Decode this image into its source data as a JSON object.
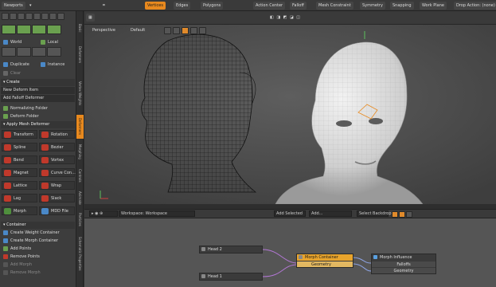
{
  "top_toolbar": {
    "layout_tab": "Newports",
    "vertices": "Vertices",
    "edges": "Edges",
    "polygons": "Polygons",
    "action_center": "Action Center",
    "falloff": "Falloff",
    "mesh_constraint": "Mesh Constraint",
    "symmetry": "Symmetry",
    "snapping": "Snapping",
    "work_plane": "Work Plane",
    "drop_action": "Drop Action: (none)"
  },
  "left_panel": {
    "world": "World",
    "local": "Local",
    "duplicate": "Duplicate",
    "instance": "Instance",
    "clear": "Clear",
    "create_header": "Create",
    "new_deform_item": "New Deform Item",
    "add_falloff_deformer": "Add Falloff Deformer",
    "normalizing_folder": "Normalizing Folder",
    "deform_folder": "Deform Folder",
    "apply_mesh_deformer": "Apply Mesh Deformer",
    "tools": [
      {
        "label": "Transform",
        "color": "#c0392b"
      },
      {
        "label": "Rotation",
        "color": "#c0392b"
      },
      {
        "label": "Spline",
        "color": "#c0392b"
      },
      {
        "label": "Bezier",
        "color": "#c0392b"
      },
      {
        "label": "Bend",
        "color": "#c0392b"
      },
      {
        "label": "Vortex",
        "color": "#c0392b"
      },
      {
        "label": "Magnet",
        "color": "#c0392b"
      },
      {
        "label": "Curve Con...",
        "color": "#c0392b"
      },
      {
        "label": "Lattice",
        "color": "#c0392b"
      },
      {
        "label": "Wrap",
        "color": "#c0392b"
      },
      {
        "label": "Lag",
        "color": "#c0392b"
      },
      {
        "label": "Slack",
        "color": "#c0392b"
      },
      {
        "label": "Morph",
        "color": "#4f8f3d"
      },
      {
        "label": "MDD File",
        "color": "#4a88c7"
      }
    ],
    "container_header": "Container",
    "create_weight_container": "Create Weight Container",
    "create_morph_container": "Create Morph Container",
    "add_points": "Add Points",
    "remove_points": "Remove Points",
    "add_morph": "Add Morph",
    "remove_morph": "Remove Morph"
  },
  "vertical_tabs": [
    "Basic",
    "Deformers",
    "Vertex Weights",
    "Deformers",
    "Morphing",
    "Controls",
    "Animate",
    "Particles",
    "Schematic Properties"
  ],
  "viewport": {
    "view_mode": "Perspective",
    "shading": "Default"
  },
  "schematic": {
    "workspace_label": "Workspace: Workspace",
    "add_selected": "Add Selected",
    "add_menu": "Add...",
    "select_backdrop": "Select Backdrop",
    "nodes": {
      "head2": "Head 2",
      "head1": "Head 1",
      "morph_container": "Morph Container",
      "morph_geometry": "Geometry",
      "morph_influence": "Morph Influence",
      "influence_falloffs": "Falloffs",
      "influence_geometry": "Geometry"
    }
  },
  "colors": {
    "accent": "#e8891e",
    "selected_node": "#e8a42c"
  }
}
